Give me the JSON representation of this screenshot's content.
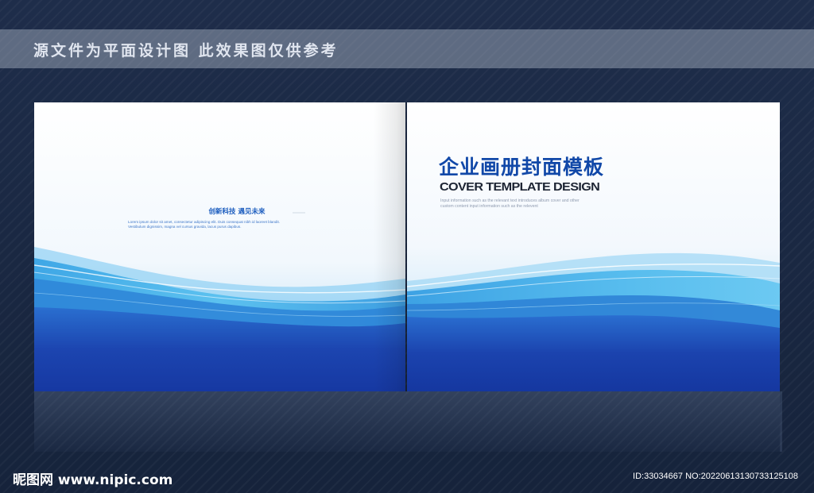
{
  "watermark": {
    "text": "源文件为平面设计图 此效果图仅供参考"
  },
  "left_page": {
    "slogan": "创新科技 遇见未来",
    "body_lines": [
      "Lorem ipsum dolor sit amet, consectetur adipiscing elit. Duis consequat nibh id laoreet blandit.",
      "Vestibulum dignissim, magna vel cursus gravida, lacus purus dapibus."
    ]
  },
  "right_page": {
    "title": "企业画册封面模板",
    "subtitle": "COVER TEMPLATE DESIGN",
    "description_lines": [
      "Input information such as the relevant text introduces album cover and other",
      "custom content input information such as the relevent"
    ]
  },
  "footer": {
    "logo": "昵图网 www.nipic.com",
    "id_text": "ID:33034667 NO:20220613130733125108"
  },
  "colors": {
    "background": "#1a2842",
    "title_blue": "#1148a8",
    "wave_deep": "#1a3fa8",
    "wave_light": "#4fb8ec"
  }
}
